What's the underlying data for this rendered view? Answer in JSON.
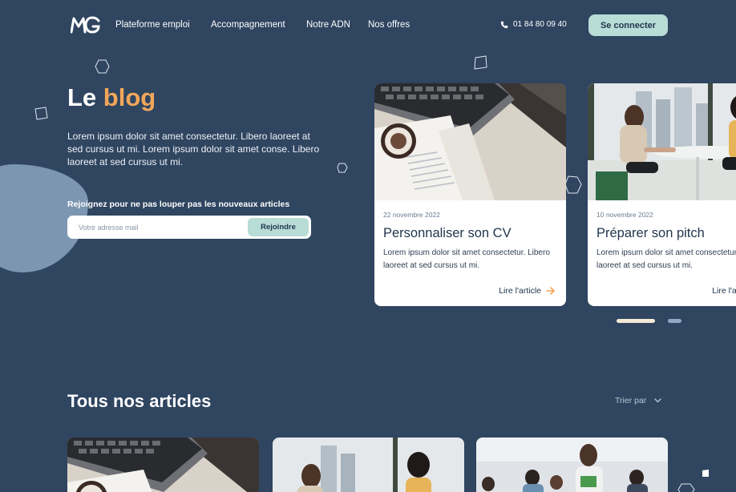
{
  "header": {
    "logo_text": "MG",
    "nav": [
      {
        "label": "Plateforme emploi"
      },
      {
        "label": "Accompagnement"
      },
      {
        "label": "Notre ADN"
      },
      {
        "label": "Nos offres"
      }
    ],
    "phone": "01 84 80 09 40",
    "connect_label": "Se connecter"
  },
  "hero": {
    "title_prefix": "Le ",
    "title_accent": "blog",
    "description": "Lorem ipsum dolor sit amet consectetur. Libero laoreet at sed cursus ut mi. Lorem ipsum dolor sit amet conse. Libero laoreet at sed cursus ut mi.",
    "newsletter_label": "Rejoignez pour ne pas louper pas les nouveaux articles",
    "newsletter_placeholder": "Votre adresse mail",
    "join_label": "Rejoindre"
  },
  "featured": [
    {
      "date": "22 novembre 2022",
      "title": "Personnaliser son CV",
      "excerpt": "Lorem ipsum dolor sit amet consectetur. Libero laoreet at sed cursus ut mi.",
      "link": "Lire l'article"
    },
    {
      "date": "10 novembre 2022",
      "title": "Préparer son pitch",
      "excerpt": "Lorem ipsum dolor sit amet consectetur. Libero laoreet at sed cursus ut mi.",
      "link": "Lire l'article"
    }
  ],
  "carousel": {
    "active_index": 0,
    "count": 2
  },
  "articles": {
    "title": "Tous nos articles",
    "sort_label": "Trier par"
  },
  "colors": {
    "background": "#2f4560",
    "accent": "#f2a65a",
    "mint": "#b8dcd6"
  }
}
